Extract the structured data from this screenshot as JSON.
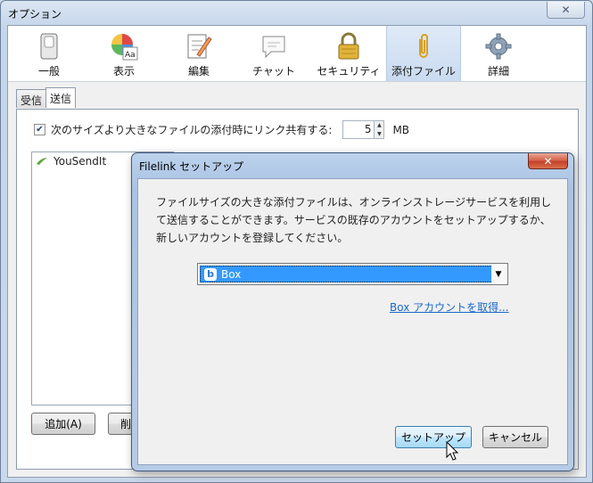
{
  "window": {
    "title": "オプション",
    "close": "✕"
  },
  "toolbar": {
    "items": [
      {
        "label": "一般"
      },
      {
        "label": "表示"
      },
      {
        "label": "編集"
      },
      {
        "label": "チャット"
      },
      {
        "label": "セキュリティ"
      },
      {
        "label": "添付ファイル"
      },
      {
        "label": "詳細"
      }
    ]
  },
  "tabs": [
    "受信",
    "送信"
  ],
  "send": {
    "checkbox_label": "次のサイズより大きなファイルの添付時にリンク共有する:",
    "size_value": "5",
    "unit": "MB",
    "accounts": [
      "YouSendIt"
    ],
    "add_button": "追加(A)",
    "remove_button": "削"
  },
  "dialog": {
    "title": "Filelink セットアップ",
    "close": "✕",
    "description": "ファイルサイズの大きな添付ファイルは、オンラインストレージサービスを利用して送信することができます。サービスの既存のアカウントをセットアップするか、新しいアカウントを登録してください。",
    "provider_selected": "Box",
    "link": "Box アカウントを取得...",
    "setup_button": "セットアップ",
    "cancel_button": "キャンセル"
  }
}
